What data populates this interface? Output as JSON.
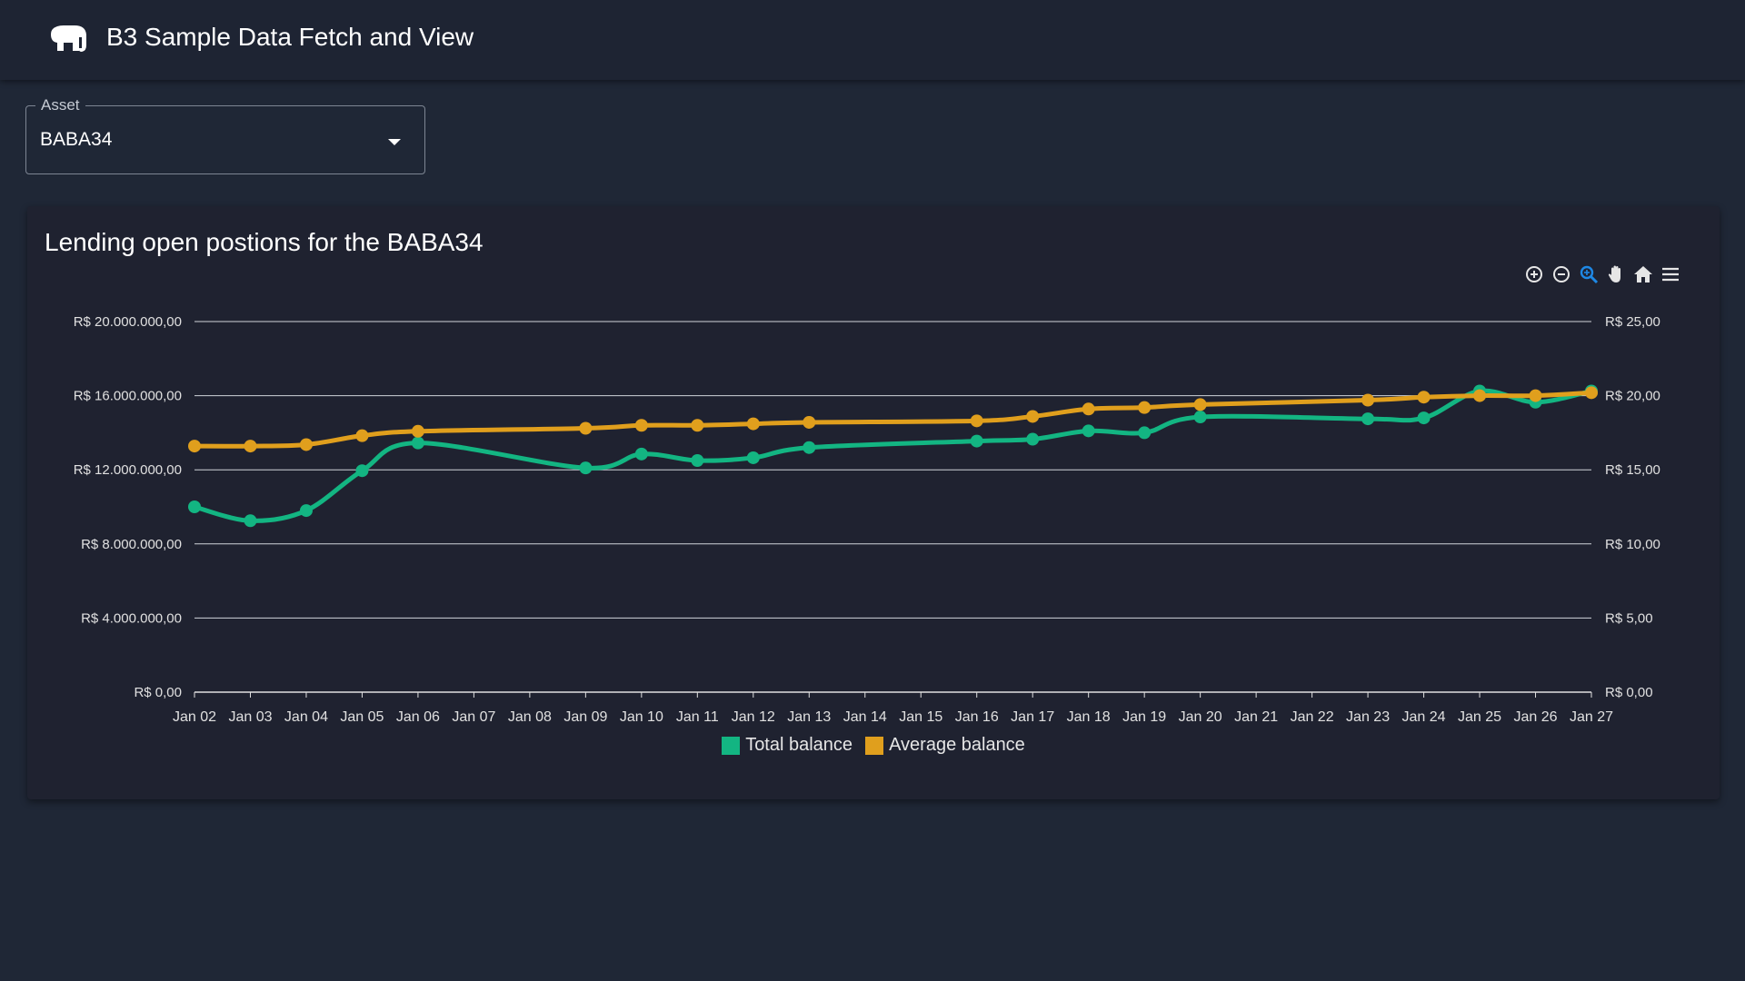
{
  "app": {
    "title": "B3 Sample Data Fetch and View"
  },
  "asset_select": {
    "label": "Asset",
    "value": "BABA34"
  },
  "chart_card": {
    "title": "Lending open postions for the BABA34"
  },
  "toolbar": [
    "zoom-in-icon",
    "zoom-out-icon",
    "zoom-selection-icon",
    "pan-icon",
    "reset-zoom-icon",
    "menu-icon"
  ],
  "colors": {
    "total": "#13b582",
    "average": "#e09f1d",
    "accent": "#1e88e5"
  },
  "chart_data": {
    "type": "line",
    "categories": [
      "Jan 02",
      "Jan 03",
      "Jan 04",
      "Jan 05",
      "Jan 06",
      "Jan 07",
      "Jan 08",
      "Jan 09",
      "Jan 10",
      "Jan 11",
      "Jan 12",
      "Jan 13",
      "Jan 14",
      "Jan 15",
      "Jan 16",
      "Jan 17",
      "Jan 18",
      "Jan 19",
      "Jan 20",
      "Jan 21",
      "Jan 22",
      "Jan 23",
      "Jan 24",
      "Jan 25",
      "Jan 26",
      "Jan 27"
    ],
    "series": [
      {
        "name": "Total balance",
        "axis": "left",
        "values": [
          10000000,
          9250000,
          9800000,
          11950000,
          13450000,
          null,
          null,
          12100000,
          12850000,
          12500000,
          12650000,
          13200000,
          null,
          null,
          13550000,
          13650000,
          14100000,
          14000000,
          14850000,
          null,
          null,
          14750000,
          14800000,
          16250000,
          15650000,
          16250000
        ]
      },
      {
        "name": "Average balance",
        "axis": "right",
        "values": [
          16.6,
          16.6,
          16.7,
          17.3,
          17.6,
          null,
          null,
          17.8,
          18.0,
          18.0,
          18.1,
          18.2,
          null,
          null,
          18.3,
          18.6,
          19.1,
          19.2,
          19.4,
          null,
          null,
          19.7,
          19.9,
          20.0,
          20.0,
          20.2
        ]
      }
    ],
    "y_left": {
      "ticks": [
        "R$ 0,00",
        "R$ 4.000.000,00",
        "R$ 8.000.000,00",
        "R$ 12.000.000,00",
        "R$ 16.000.000,00",
        "R$ 20.000.000,00"
      ],
      "ylim": [
        0,
        20000000
      ]
    },
    "y_right": {
      "ticks": [
        "R$ 0,00",
        "R$ 5,00",
        "R$ 10,00",
        "R$ 15,00",
        "R$ 20,00",
        "R$ 25,00"
      ],
      "ylim": [
        0,
        25
      ]
    },
    "grid": true,
    "legend": [
      "Total balance",
      "Average balance"
    ],
    "legend_position": "bottom-center"
  }
}
